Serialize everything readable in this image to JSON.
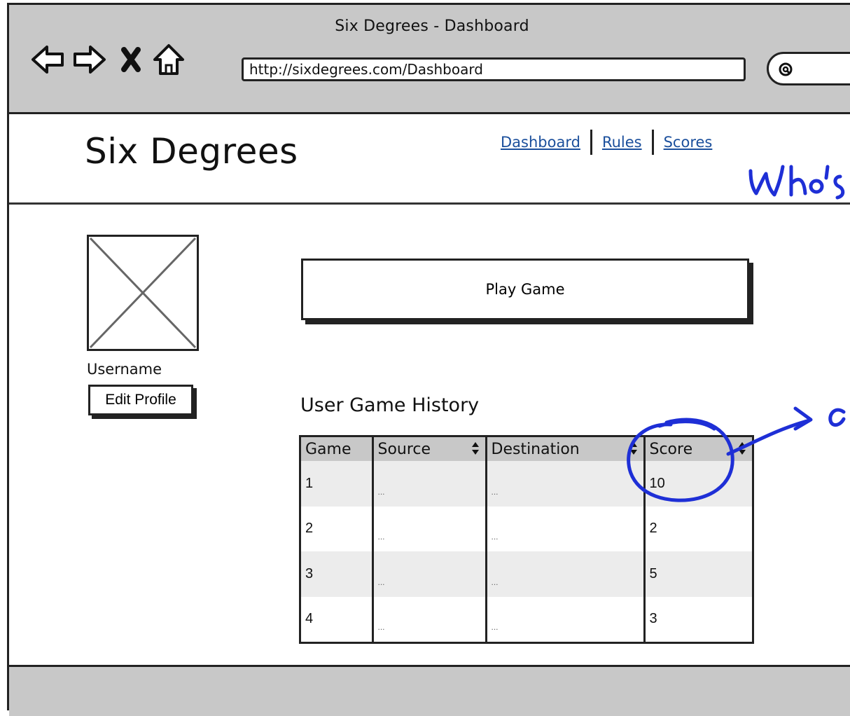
{
  "window": {
    "title": "Six Degrees - Dashboard"
  },
  "browser": {
    "url": "http://sixdegrees.com/Dashboard",
    "search_value": ""
  },
  "header": {
    "brand": "Six Degrees",
    "nav": [
      {
        "label": "Dashboard"
      },
      {
        "label": "Rules"
      },
      {
        "label": "Scores"
      }
    ]
  },
  "profile": {
    "username": "Username",
    "edit_label": "Edit Profile"
  },
  "main": {
    "play_label": "Play Game",
    "history_title": "User Game History"
  },
  "history": {
    "columns": [
      "Game",
      "Source",
      "Destination",
      "Score"
    ],
    "rows": [
      {
        "game": "1",
        "source": "...",
        "destination": "...",
        "score": "10"
      },
      {
        "game": "2",
        "source": "...",
        "destination": "...",
        "score": "2"
      },
      {
        "game": "3",
        "source": "...",
        "destination": "...",
        "score": "5"
      },
      {
        "game": "4",
        "source": "...",
        "destination": "...",
        "score": "3"
      }
    ]
  },
  "annotations": {
    "ink_color": "#1e2fd6"
  }
}
